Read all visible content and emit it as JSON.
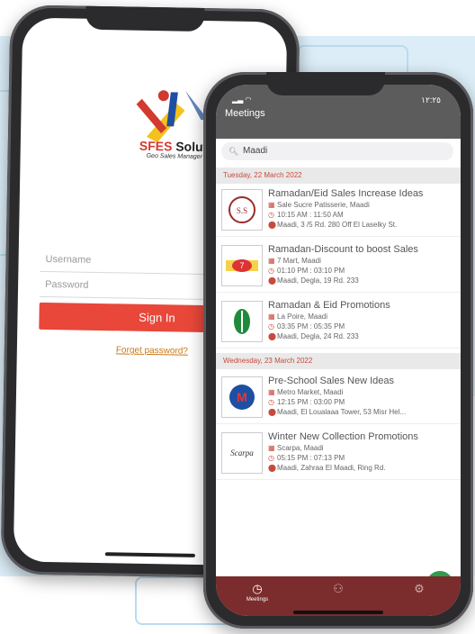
{
  "login": {
    "brand": {
      "sfes": "SFES",
      "solutions": " Solutions",
      "tagline": "Geo Sales Manager"
    },
    "username_placeholder": "Username",
    "password_placeholder": "Password",
    "sign_in_label": "Sign In",
    "forgot_label": "Forget password?"
  },
  "meetings": {
    "status_time": "١٢:٢٥",
    "title": "Meetings",
    "search_value": "Maadi",
    "sections": [
      {
        "date": "Tuesday, 22 March 2022",
        "items": [
          {
            "title": "Ramadan/Eid Sales Increase Ideas",
            "place": "Sale Sucre Patisserie, Maadi",
            "time": "10:15 AM : 11:50 AM",
            "address": "Maadi, 3 /5 Rd. 280 Off El Laselky St."
          },
          {
            "title": "Ramadan-Discount to boost Sales",
            "place": "7 Mart, Maadi",
            "time": "01:10 PM : 03:10 PM",
            "address": "Maadi, Degla, 19 Rd. 233"
          },
          {
            "title": "Ramadan & Eid Promotions",
            "place": "La Poire, Maadi",
            "time": "03:35 PM : 05:35 PM",
            "address": "Maadi, Degla, 24 Rd. 233"
          }
        ]
      },
      {
        "date": "Wednesday, 23 March 2022",
        "items": [
          {
            "title": "Pre-School Sales New Ideas",
            "place": "Metro Market, Maadi",
            "time": "12:15 PM : 03:00 PM",
            "address": "Maadi, El Loualaaa Tower, 53 Misr Hel..."
          },
          {
            "title": "Winter New Collection Promotions",
            "place": "Scarpa, Maadi",
            "time": "05:15 PM : 07:13 PM",
            "address": "Maadi, Zahraa El Maadi, Ring Rd."
          }
        ]
      }
    ],
    "thumb_labels": [
      "S.S",
      "7",
      "",
      "M",
      "Scarpa"
    ],
    "fab_label": "+",
    "tabs": [
      {
        "label": "Meetings"
      },
      {
        "label": ""
      },
      {
        "label": ""
      }
    ]
  },
  "colors": {
    "accent_red": "#e8473a",
    "tab_bar": "#7b2c2c",
    "fab_green": "#2e9c4a"
  }
}
